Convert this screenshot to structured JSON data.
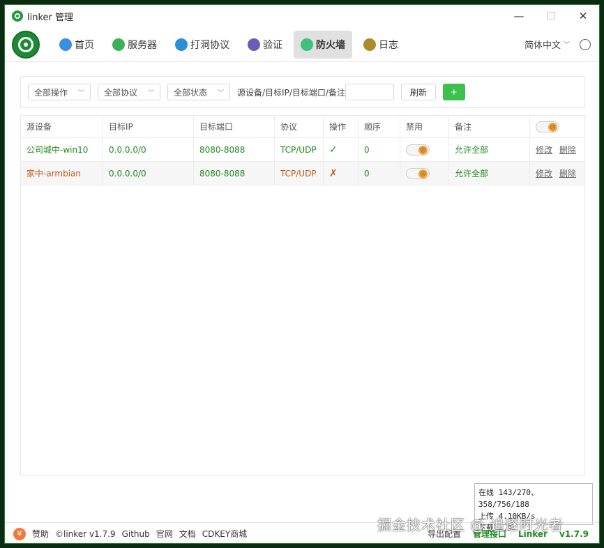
{
  "window": {
    "title": "linker 管理",
    "min": "—",
    "max": "☐",
    "close": "✕"
  },
  "nav": {
    "items": [
      {
        "label": "首页",
        "icon": "home-icon",
        "color": "#3b8fe0"
      },
      {
        "label": "服务器",
        "icon": "cloud-icon",
        "color": "#3cb15a"
      },
      {
        "label": "打洞协议",
        "icon": "punch-icon",
        "color": "#2a8fd6"
      },
      {
        "label": "验证",
        "icon": "lock-icon",
        "color": "#6b5cb8"
      },
      {
        "label": "防火墙",
        "icon": "shield-icon",
        "color": "#3cc27a"
      },
      {
        "label": "日志",
        "icon": "log-icon",
        "color": "#b08a2a"
      }
    ],
    "active_index": 4,
    "language": "简体中文"
  },
  "toolbar": {
    "op_select": "全部操作",
    "proto_select": "全部协议",
    "state_select": "全部状态",
    "filter_label": "源设备/目标IP/目标端口/备注",
    "filter_value": "",
    "refresh": "刷新",
    "add": "+"
  },
  "table": {
    "headers": [
      "源设备",
      "目标IP",
      "目标端口",
      "协议",
      "操作",
      "顺序",
      "禁用",
      "备注"
    ],
    "rows": [
      {
        "src": "公司城中-win10",
        "ip": "0.0.0.0/0",
        "port": "8080-8088",
        "proto": "TCP/UDP",
        "op": "✓",
        "order": "0",
        "note": "允许全部",
        "edit": "修改",
        "del": "删除",
        "color": "green"
      },
      {
        "src": "家中-armbian",
        "ip": "0.0.0.0/0",
        "port": "8080-8088",
        "proto": "TCP/UDP",
        "op": "✗",
        "order": "0",
        "note": "允许全部",
        "edit": "修改",
        "del": "删除",
        "color": "orange"
      }
    ]
  },
  "status": {
    "online": "在线 143/270、358/756/188",
    "upload": "上传 4.10KB/s",
    "download": "下载 2.2"
  },
  "footer": {
    "sponsor": "赞助",
    "copyright": "©linker v1.7.9",
    "github": "Github",
    "website": "官网",
    "docs": "文档",
    "cdkey": "CDKEY商城",
    "export": "导出配置",
    "manage": "管理接口",
    "user": "Linker",
    "version": "v1.7.9"
  },
  "watermark": "掘金技术社区 @ 追逐时光者"
}
